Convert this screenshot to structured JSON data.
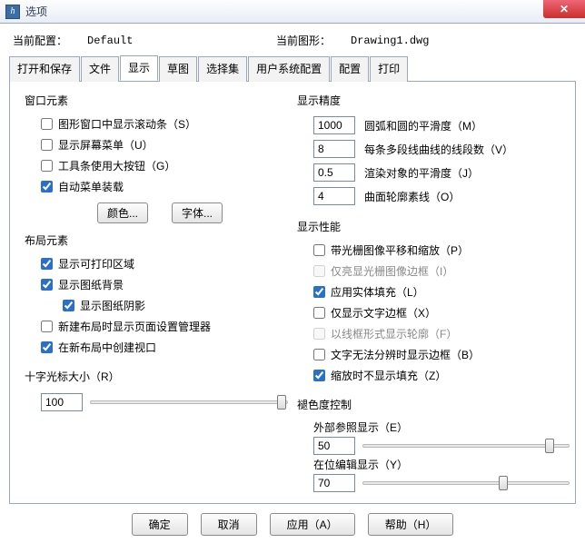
{
  "window": {
    "title": "选项",
    "app_icon_letter": "h"
  },
  "config": {
    "current_config_label": "当前配置：",
    "current_config_value": "Default",
    "current_drawing_label": "当前图形：",
    "current_drawing_value": "Drawing1.dwg"
  },
  "tabs": {
    "open_save": "打开和保存",
    "file": "文件",
    "display": "显示",
    "sketch": "草图",
    "selection": "选择集",
    "user_sys": "用户系统配置",
    "config": "配置",
    "print": "打印"
  },
  "left": {
    "window_elements": {
      "title": "窗口元素",
      "scrollbars": "图形窗口中显示滚动条（S）",
      "screen_menu": "显示屏幕菜单（U）",
      "large_buttons": "工具条使用大按钮（G）",
      "auto_menu": "自动菜单装载",
      "color_btn": "颜色...",
      "font_btn": "字体..."
    },
    "layout_elements": {
      "title": "布局元素",
      "printable_area": "显示可打印区域",
      "paper_bg": "显示图纸背景",
      "paper_shadow": "显示图纸阴影",
      "page_setup_mgr": "新建布局时显示页面设置管理器",
      "create_viewport": "在新布局中创建视口"
    },
    "crosshair": {
      "title": "十字光标大小（R）",
      "value": "100"
    }
  },
  "right": {
    "precision": {
      "title": "显示精度",
      "arc_smooth": {
        "value": "1000",
        "label": "圆弧和圆的平滑度（M）"
      },
      "polyline_segs": {
        "value": "8",
        "label": "每条多段线曲线的线段数（V）"
      },
      "render_smooth": {
        "value": "0.5",
        "label": "渲染对象的平滑度（J）"
      },
      "surface_lines": {
        "value": "4",
        "label": "曲面轮廓素线（O）"
      }
    },
    "performance": {
      "title": "显示性能",
      "pan_zoom_raster": "带光栅图像平移和缩放（P）",
      "highlight_raster": "仅亮显光栅图像边框（I）",
      "solid_fill": "应用实体填充（L）",
      "text_frame": "仅显示文字边框（X）",
      "wireframe_silhouette": "以线框形式显示轮廓（F）",
      "cant_resolve_text": "文字无法分辨时显示边框（B）",
      "hide_fill_zoom": "缩放时不显示填充（Z）"
    },
    "fade": {
      "title": "褪色度控制",
      "xref_label": "外部参照显示（E）",
      "xref_value": "50",
      "inplace_label": "在位编辑显示（Y）",
      "inplace_value": "70"
    }
  },
  "footer": {
    "ok": "确定",
    "cancel": "取消",
    "apply": "应用（A）",
    "help": "帮助（H）"
  }
}
